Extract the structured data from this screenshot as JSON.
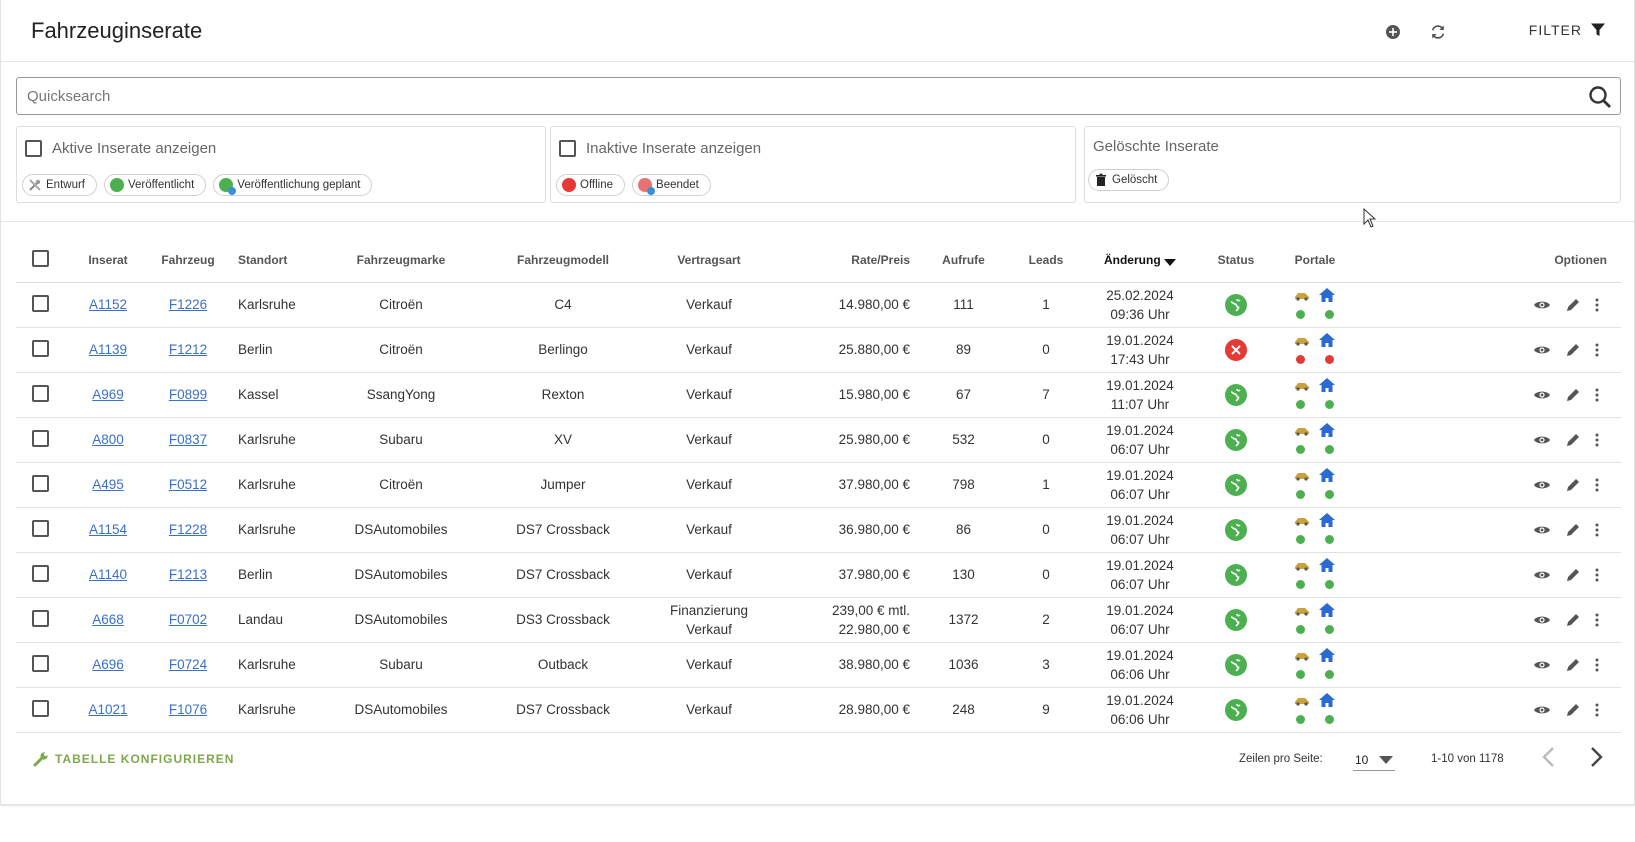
{
  "header": {
    "title": "Fahrzeuginserate",
    "filter_label": "FILTER"
  },
  "search": {
    "placeholder": "Quicksearch",
    "value": ""
  },
  "filters": {
    "active": {
      "label": "Aktive Inserate anzeigen",
      "chips": [
        "Entwurf",
        "Veröffentlicht",
        "Veröffentlichung geplant"
      ]
    },
    "inactive": {
      "label": "Inaktive Inserate anzeigen",
      "chips": [
        "Offline",
        "Beendet"
      ]
    },
    "deleted": {
      "label": "Gelöschte Inserate",
      "chips": [
        "Gelöscht"
      ]
    }
  },
  "table": {
    "headers": [
      "Inserat",
      "Fahrzeug",
      "Standort",
      "Fahrzeugmarke",
      "Fahrzeugmodell",
      "Vertragsart",
      "Rate/Preis",
      "Aufrufe",
      "Leads",
      "Änderung",
      "Status",
      "Portale",
      "Optionen"
    ],
    "rows": [
      {
        "inserat": "A1152",
        "fahrzeug": "F1226",
        "standort": "Karlsruhe",
        "marke": "Citroën",
        "modell": "C4",
        "vertrag1": "Verkauf",
        "vertrag2": "",
        "preis1": "14.980,00 €",
        "preis2": "",
        "aufrufe": "111",
        "leads": "1",
        "datum": "25.02.2024",
        "zeit": "09:36 Uhr",
        "status": "online"
      },
      {
        "inserat": "A1139",
        "fahrzeug": "F1212",
        "standort": "Berlin",
        "marke": "Citroën",
        "modell": "Berlingo",
        "vertrag1": "Verkauf",
        "vertrag2": "",
        "preis1": "25.880,00 €",
        "preis2": "",
        "aufrufe": "89",
        "leads": "0",
        "datum": "19.01.2024",
        "zeit": "17:43 Uhr",
        "status": "offline"
      },
      {
        "inserat": "A969",
        "fahrzeug": "F0899",
        "standort": "Kassel",
        "marke": "SsangYong",
        "modell": "Rexton",
        "vertrag1": "Verkauf",
        "vertrag2": "",
        "preis1": "15.980,00 €",
        "preis2": "",
        "aufrufe": "67",
        "leads": "7",
        "datum": "19.01.2024",
        "zeit": "11:07 Uhr",
        "status": "online"
      },
      {
        "inserat": "A800",
        "fahrzeug": "F0837",
        "standort": "Karlsruhe",
        "marke": "Subaru",
        "modell": "XV",
        "vertrag1": "Verkauf",
        "vertrag2": "",
        "preis1": "25.980,00 €",
        "preis2": "",
        "aufrufe": "532",
        "leads": "0",
        "datum": "19.01.2024",
        "zeit": "06:07 Uhr",
        "status": "online"
      },
      {
        "inserat": "A495",
        "fahrzeug": "F0512",
        "standort": "Karlsruhe",
        "marke": "Citroën",
        "modell": "Jumper",
        "vertrag1": "Verkauf",
        "vertrag2": "",
        "preis1": "37.980,00 €",
        "preis2": "",
        "aufrufe": "798",
        "leads": "1",
        "datum": "19.01.2024",
        "zeit": "06:07 Uhr",
        "status": "online"
      },
      {
        "inserat": "A1154",
        "fahrzeug": "F1228",
        "standort": "Karlsruhe",
        "marke": "DSAutomobiles",
        "modell": "DS7 Crossback",
        "vertrag1": "Verkauf",
        "vertrag2": "",
        "preis1": "36.980,00 €",
        "preis2": "",
        "aufrufe": "86",
        "leads": "0",
        "datum": "19.01.2024",
        "zeit": "06:07 Uhr",
        "status": "online"
      },
      {
        "inserat": "A1140",
        "fahrzeug": "F1213",
        "standort": "Berlin",
        "marke": "DSAutomobiles",
        "modell": "DS7 Crossback",
        "vertrag1": "Verkauf",
        "vertrag2": "",
        "preis1": "37.980,00 €",
        "preis2": "",
        "aufrufe": "130",
        "leads": "0",
        "datum": "19.01.2024",
        "zeit": "06:07 Uhr",
        "status": "online"
      },
      {
        "inserat": "A668",
        "fahrzeug": "F0702",
        "standort": "Landau",
        "marke": "DSAutomobiles",
        "modell": "DS3 Crossback",
        "vertrag1": "Finanzierung",
        "vertrag2": "Verkauf",
        "preis1": "239,00 € mtl.",
        "preis2": "22.980,00 €",
        "aufrufe": "1372",
        "leads": "2",
        "datum": "19.01.2024",
        "zeit": "06:07 Uhr",
        "status": "online"
      },
      {
        "inserat": "A696",
        "fahrzeug": "F0724",
        "standort": "Karlsruhe",
        "marke": "Subaru",
        "modell": "Outback",
        "vertrag1": "Verkauf",
        "vertrag2": "",
        "preis1": "38.980,00 €",
        "preis2": "",
        "aufrufe": "1036",
        "leads": "3",
        "datum": "19.01.2024",
        "zeit": "06:06 Uhr",
        "status": "online"
      },
      {
        "inserat": "A1021",
        "fahrzeug": "F1076",
        "standort": "Karlsruhe",
        "marke": "DSAutomobiles",
        "modell": "DS7 Crossback",
        "vertrag1": "Verkauf",
        "vertrag2": "",
        "preis1": "28.980,00 €",
        "preis2": "",
        "aufrufe": "248",
        "leads": "9",
        "datum": "19.01.2024",
        "zeit": "06:06 Uhr",
        "status": "online"
      }
    ]
  },
  "footer": {
    "configure_label": "TABELLE KONFIGURIEREN",
    "rows_label": "Zeilen pro Seite:",
    "rows_value": "10",
    "range": "1-10 von 1178"
  },
  "colors": {
    "online": "#4caf50",
    "offline": "#e53935",
    "link": "#3a6fcc",
    "accent": "#7fa84a",
    "portal_home": "#2a6ad1"
  }
}
